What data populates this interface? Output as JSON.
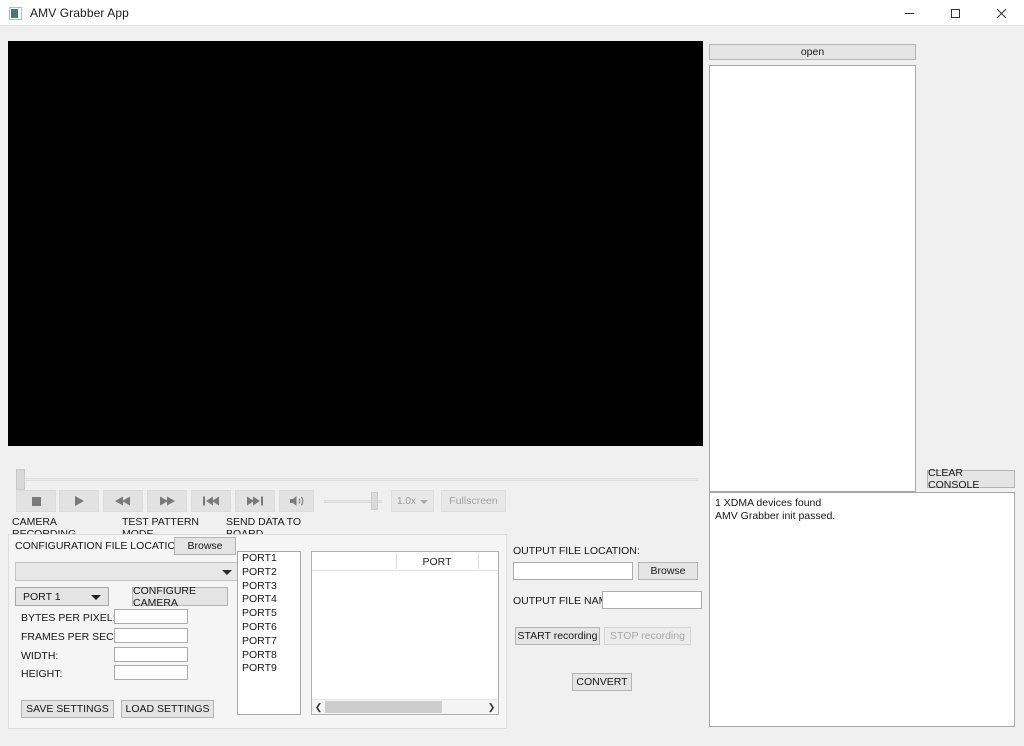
{
  "window": {
    "title": "AMV Grabber App",
    "icon": "app-window-icon",
    "controls": {
      "minimize": "minimize-icon",
      "maximize": "maximize-icon",
      "close": "close-icon"
    }
  },
  "player": {
    "video_background": "#000000",
    "seek_position_percent": 0,
    "buttons": [
      {
        "name": "stop",
        "icon": "stop-icon"
      },
      {
        "name": "play",
        "icon": "play-icon"
      },
      {
        "name": "rewind",
        "icon": "rewind-icon"
      },
      {
        "name": "fast-forward",
        "icon": "fast-forward-icon"
      },
      {
        "name": "skip-previous",
        "icon": "skip-previous-icon"
      },
      {
        "name": "skip-next",
        "icon": "skip-next-icon"
      },
      {
        "name": "volume",
        "icon": "volume-icon"
      }
    ],
    "volume_percent": 100,
    "speed": "1.0x",
    "fullscreen_label": "Fullscreen",
    "fullscreen_enabled": false
  },
  "tabs": [
    {
      "label": "CAMERA RECORDING",
      "active": true
    },
    {
      "label": "TEST PATTERN MODE",
      "active": false
    },
    {
      "label": "SEND DATA TO BOARD",
      "active": false
    }
  ],
  "camera_recording": {
    "config_location_label": "CONFIGURATION FILE LOCATION:",
    "browse_label": "Browse",
    "config_combo_value": "",
    "port_combo_value": "PORT 1",
    "configure_camera_label": "CONFIGURE CAMERA",
    "fields": [
      {
        "label": "BYTES PER PIXEL:",
        "value": ""
      },
      {
        "label": "FRAMES PER SECOND:",
        "value": ""
      },
      {
        "label": "WIDTH:",
        "value": ""
      },
      {
        "label": "HEIGHT:",
        "value": ""
      }
    ],
    "save_settings_label": "SAVE SETTINGS",
    "load_settings_label": "LOAD SETTINGS",
    "port_list": [
      "PORT1",
      "PORT2",
      "PORT3",
      "PORT4",
      "PORT5",
      "PORT6",
      "PORT7",
      "PORT8",
      "PORT9"
    ],
    "port_table": {
      "header": "PORT",
      "rows": [],
      "scroll_left_icon": "chevron-left-icon",
      "scroll_right_icon": "chevron-right-icon"
    }
  },
  "output": {
    "file_location_label": "OUTPUT FILE LOCATION:",
    "file_location_value": "",
    "browse_label": "Browse",
    "file_name_label": "OUTPUT FILE NAME:",
    "file_name_value": "",
    "start_recording_label": "START recording",
    "stop_recording_label": "STOP recording",
    "stop_recording_enabled": false,
    "convert_label": "CONVERT"
  },
  "right_panel": {
    "open_label": "open",
    "file_list": [],
    "clear_console_label": "CLEAR CONSOLE",
    "console_lines": [
      "1 XDMA devices found",
      "AMV Grabber init passed."
    ]
  }
}
